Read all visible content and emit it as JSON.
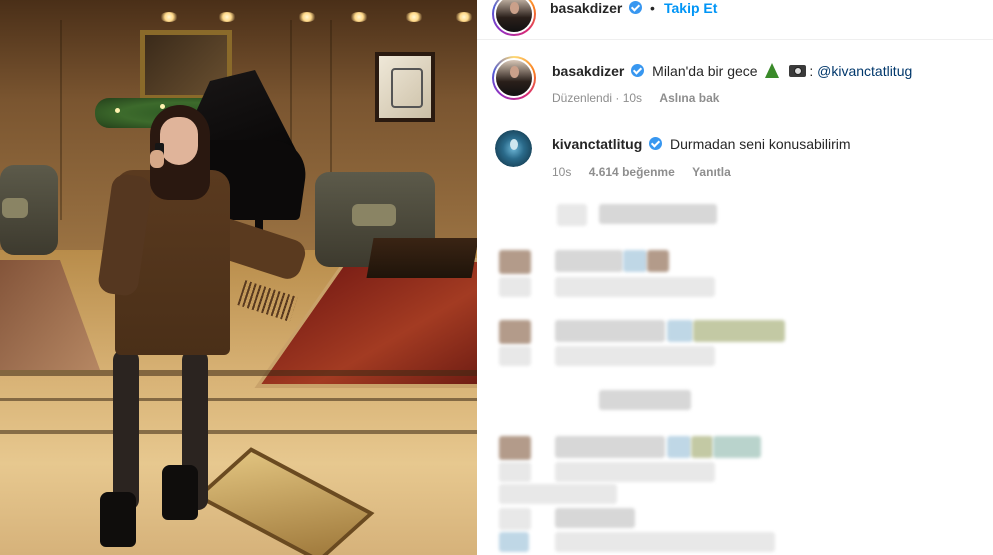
{
  "header": {
    "username": "basakdizer",
    "follow_label": "Takip Et",
    "separator": "•"
  },
  "post_caption": {
    "username": "basakdizer",
    "text_before": "Milan'da bir gece",
    "mention": "@kivanctatlitug",
    "meta": {
      "edited": "Düzenlendi · 10s",
      "see_original": "Aslına bak"
    }
  },
  "comments": [
    {
      "username": "kivanctatlitug",
      "text": "Durmadan seni konusabilirim",
      "time": "10s",
      "likes": "4.614 beğenme",
      "reply_label": "Yanıtla"
    }
  ],
  "icons": {
    "verified": "verified-badge-icon",
    "tree": "christmas-tree-icon",
    "camera": "camera-icon"
  },
  "colors": {
    "accent_blue": "#0095f6",
    "verified_blue": "#3897f0",
    "mention": "#00376b",
    "meta_grey": "#8e8e8e"
  }
}
